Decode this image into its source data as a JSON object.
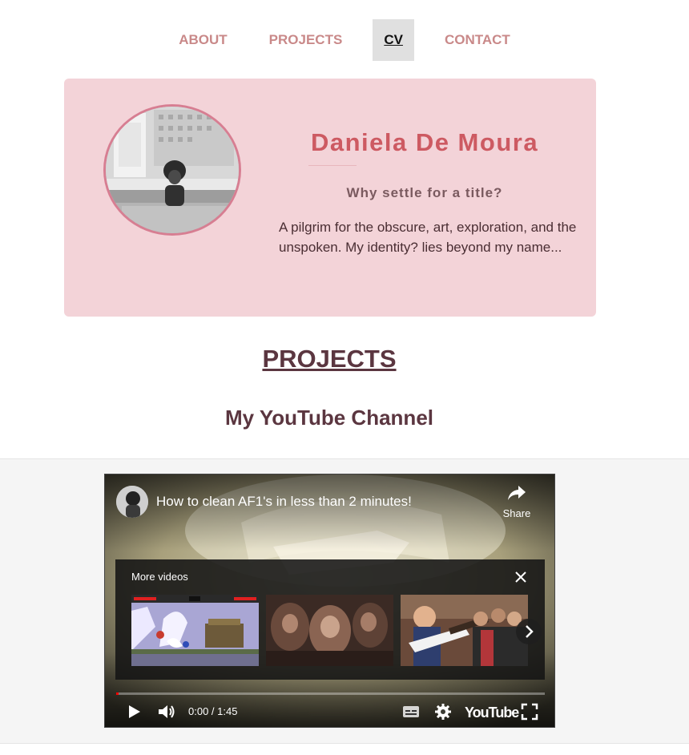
{
  "nav": {
    "items": [
      {
        "label": "ABOUT",
        "active": false
      },
      {
        "label": "PROJECTS",
        "active": false
      },
      {
        "label": "CV",
        "active": true
      },
      {
        "label": "CONTACT",
        "active": false
      }
    ]
  },
  "hero": {
    "name": "Daniela De Moura",
    "tagline": "Why settle for a title?",
    "bio": "A pilgrim for the obscure, art, exploration, and the unspoken. My identity? lies beyond my name..."
  },
  "projects": {
    "section_title": "PROJECTS",
    "youtube_title": "My YouTube Channel"
  },
  "player": {
    "video_title": "How to clean AF1's in less than 2 minutes!",
    "share_label": "Share",
    "more_videos_label": "More videos",
    "time": "0:00 / 1:45",
    "logo": "YouTube",
    "progress_fraction": 0.005
  },
  "colors": {
    "accent": "#cd5a62",
    "card_bg": "#f3d3d8",
    "nav_text": "#c98989",
    "heading": "#5b3640",
    "youtube_red": "#ff0000"
  }
}
